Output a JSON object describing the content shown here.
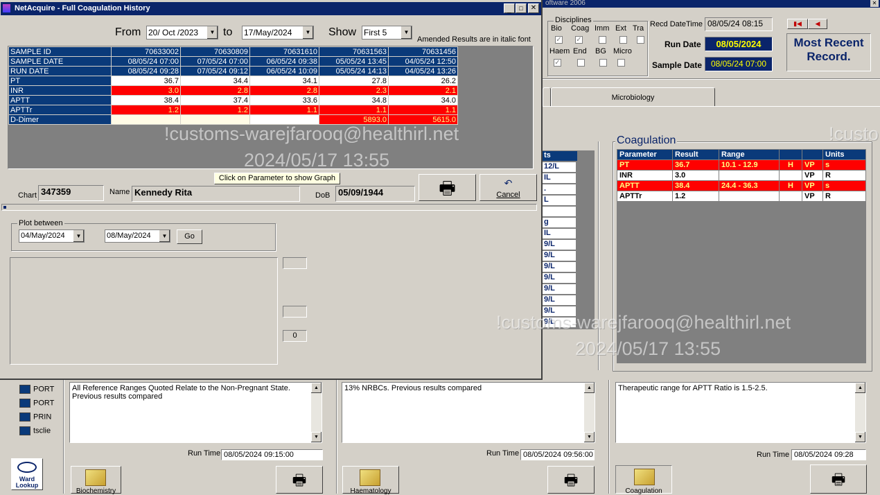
{
  "bg_app": {
    "title_fragment": "oftware 2006",
    "disciplines": {
      "legend": "Disciplines",
      "row1": [
        "Bio",
        "Coag",
        "Imm",
        "Ext",
        "Tra"
      ],
      "row2": [
        "Haem",
        "End",
        "BG",
        "Micro"
      ]
    },
    "recd_label": "Recd DateTime",
    "recd_value": "08/05/24 08:15",
    "run_date_label": "Run Date",
    "run_date_value": "08/05/2024",
    "sample_date_label": "Sample Date",
    "sample_date_value": "08/05/24 07:00",
    "most_recent": "Most Recent Record.",
    "tab_microbiology": "Microbiology",
    "coag_title": "Coagulation",
    "coag_headers": [
      "Parameter",
      "Result",
      "Range",
      "",
      "",
      "Units"
    ],
    "coag_rows": [
      {
        "p": "PT",
        "r": "36.7",
        "range": "10.1 - 12.9",
        "f": "H",
        "v": "VP",
        "u": "s",
        "hi": true
      },
      {
        "p": "INR",
        "r": "3.0",
        "range": "",
        "f": "",
        "v": "VP",
        "u": "R",
        "hi": false
      },
      {
        "p": "APTT",
        "r": "38.4",
        "range": "24.4 - 36.3",
        "f": "H",
        "v": "VP",
        "u": "s",
        "hi": true
      },
      {
        "p": "APTTr",
        "r": "1.2",
        "range": "",
        "f": "",
        "v": "VP",
        "u": "R",
        "hi": false
      }
    ],
    "haem_col_header": "ts",
    "haem_col": [
      "12/L",
      "IL",
      ".",
      "L",
      "",
      "g",
      "IL",
      "9/L",
      "9/L",
      "9/L",
      "9/L",
      "9/L",
      "9/L",
      "9/L",
      "9/L"
    ],
    "memo_bio": "All Reference Ranges Quoted  Relate to the Non-Pregnant State. Previous results compared",
    "memo_haem": "13% NRBCs. Previous results compared",
    "memo_coag": "Therapeutic range for APTT Ratio is 1.5-2.5.",
    "runtime_label": "Run Time",
    "runtime_bio": "08/05/2024 09:15:00",
    "runtime_haem": "08/05/2024 09:56:00",
    "runtime_coag": "08/05/2024 09:28",
    "btn_bio": "Biochemistry",
    "btn_haem": "Haematology",
    "btn_coag": "Coagulation",
    "tree": [
      "PORT",
      "PORT",
      "PRIN",
      "tsclie"
    ],
    "ward_lookup": "Ward Lookup"
  },
  "dialog": {
    "title": "NetAcquire - Full Coagulation History",
    "from_label": "From",
    "from_value": "20/ Oct /2023",
    "to_label": "to",
    "to_value": "17/May/2024",
    "show_label": "Show",
    "show_value": "First 5",
    "amended_note": "Amended  Results are in italic font",
    "grid": {
      "row_labels": [
        "SAMPLE ID",
        "SAMPLE DATE",
        "RUN DATE",
        "PT",
        "INR",
        "APTT",
        "APTTr",
        "D-Dimer"
      ],
      "columns": [
        {
          "cells": [
            "70633002",
            "08/05/24 07:00",
            "08/05/24 09:28",
            "36.7",
            "3.0",
            "38.4",
            "1.2",
            ""
          ]
        },
        {
          "cells": [
            "70630809",
            "07/05/24 07:00",
            "07/05/24 09:12",
            "34.4",
            "2.8",
            "37.4",
            "1.2",
            ""
          ]
        },
        {
          "cells": [
            "70631610",
            "06/05/24 09:38",
            "06/05/24 10:09",
            "34.1",
            "2.8",
            "33.6",
            "1.1",
            ""
          ]
        },
        {
          "cells": [
            "70631563",
            "05/05/24 13:45",
            "05/05/24 14:13",
            "27.8",
            "2.3",
            "34.8",
            "1.1",
            "5893.0"
          ]
        },
        {
          "cells": [
            "70631456",
            "04/05/24 12:50",
            "04/05/24 13:26",
            "26.2",
            "2.1",
            "34.0",
            "1.1",
            "5615.0"
          ]
        }
      ]
    },
    "graph_hint": "Click on Parameter to show Graph",
    "cancel_label": "Cancel",
    "chart_label": "Chart",
    "chart_value": "347359",
    "name_label": "Name",
    "name_value": "Kennedy Rita",
    "dob_label": "DoB",
    "dob_value": "05/09/1944",
    "plot_between": "Plot between",
    "plot_from": "04/May/2024",
    "plot_to": "08/May/2024",
    "go_label": "Go",
    "side_box_value": "0"
  },
  "watermark": {
    "line1": "!customs-warejfarooq@healthirl.net",
    "line2": "2024/05/17 13:55",
    "edge": "!custo"
  }
}
